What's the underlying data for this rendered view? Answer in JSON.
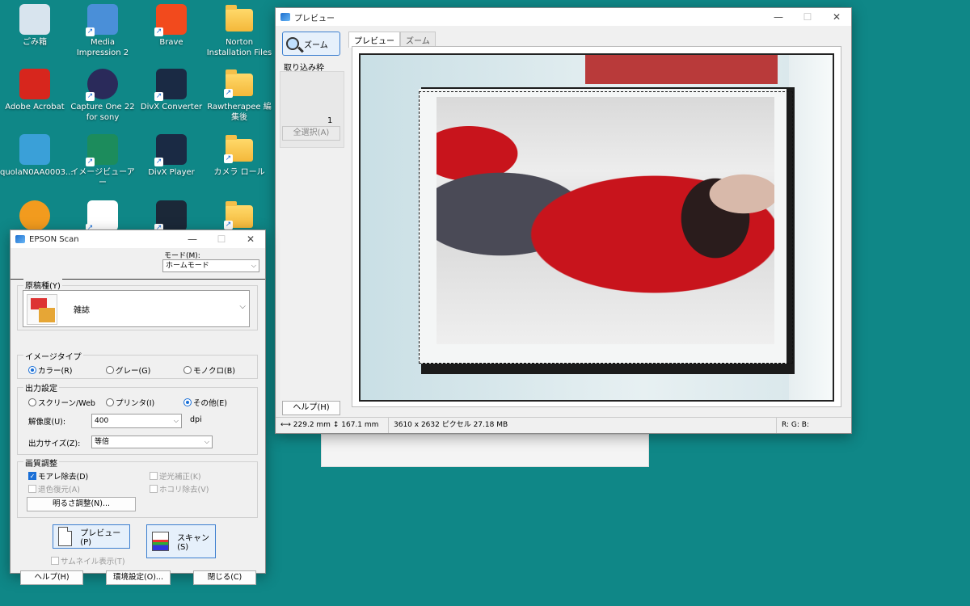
{
  "desktop": {
    "icons": [
      {
        "label": "ごみ箱",
        "icon": "recycle-bin-icon",
        "color": "#d8e4ee"
      },
      {
        "label": "Media Impression 2",
        "icon": "media-impression-icon",
        "color": "#4a8fd8"
      },
      {
        "label": "Brave",
        "icon": "brave-icon",
        "color": "#f24a1d"
      },
      {
        "label": "Norton Installation Files",
        "icon": "folder-icon",
        "color": "#f4c04a"
      },
      {
        "label": "Adobe Acrobat",
        "icon": "adobe-acrobat-icon",
        "color": "#d7261d"
      },
      {
        "label": "Capture One 22 for sony",
        "icon": "capture-one-icon",
        "color": "#2a2a5a"
      },
      {
        "label": "DivX Converter",
        "icon": "divx-converter-icon",
        "color": "#1a2a44"
      },
      {
        "label": "Rawtherapee 編集後",
        "icon": "folder-icon",
        "color": "#f4c04a"
      },
      {
        "label": "quolaN0AA0003...",
        "icon": "laptop-icon",
        "color": "#3aa0d8"
      },
      {
        "label": "イメージビューアー",
        "icon": "fujifilm-icon",
        "color": "#1c8c5c"
      },
      {
        "label": "DivX Player",
        "icon": "divx-player-icon",
        "color": "#1a2a44"
      },
      {
        "label": "カメラ ロール",
        "icon": "folder-icon",
        "color": "#f4c04a"
      },
      {
        "label": "",
        "icon": "color-wheel-icon",
        "color": "#f29b1e"
      },
      {
        "label": "",
        "icon": "cloud-upload-icon",
        "color": "#ffffff"
      },
      {
        "label": "",
        "icon": "steam-icon",
        "color": "#1b2838"
      },
      {
        "label": "",
        "icon": "folder-icon",
        "color": "#f4c04a"
      }
    ]
  },
  "preview_window": {
    "title": "プレビュー",
    "zoom_button": "ズーム",
    "frame_label": "取り込み枠",
    "frame_count": "1",
    "select_all": "全選択(A)",
    "help": "ヘルプ(H)",
    "tabs": [
      {
        "label": "プレビュー",
        "active": true
      },
      {
        "label": "ズーム",
        "active": false
      }
    ],
    "status": {
      "width": "229.2 mm",
      "height": "167.1 mm",
      "pixels": "3610 x 2632 ピクセル 27.18 MB",
      "rgb": "R: G: B:"
    }
  },
  "epson_window": {
    "title": "EPSON Scan",
    "mode_label": "モード(M):",
    "mode_value": "ホームモード",
    "document_type_label": "原稿種(Y)",
    "document_type_value": "雑誌",
    "image_type_label": "イメージタイプ",
    "image_types": [
      {
        "label": "カラー(R)",
        "selected": true
      },
      {
        "label": "グレー(G)",
        "selected": false
      },
      {
        "label": "モノクロ(B)",
        "selected": false
      }
    ],
    "output_label": "出力設定",
    "outputs": [
      {
        "label": "スクリーン/Web",
        "selected": false
      },
      {
        "label": "プリンタ(I)",
        "selected": false
      },
      {
        "label": "その他(E)",
        "selected": true
      }
    ],
    "resolution_label": "解像度(U):",
    "resolution_value": "400",
    "resolution_unit": "dpi",
    "output_size_label": "出力サイズ(Z):",
    "output_size_value": "等倍",
    "quality_label": "画質調整",
    "quality_options": [
      {
        "label": "モアレ除去(D)",
        "checked": true,
        "enabled": true
      },
      {
        "label": "逆光補正(K)",
        "checked": false,
        "enabled": false
      },
      {
        "label": "退色復元(A)",
        "checked": false,
        "enabled": false
      },
      {
        "label": "ホコリ除去(V)",
        "checked": false,
        "enabled": false
      }
    ],
    "brightness_button": "明るさ調整(N)...",
    "preview_button": "プレビュー(P)",
    "scan_button": "スキャン(S)",
    "thumbnail_label": "サムネイル表示(T)",
    "help_button": "ヘルプ(H)",
    "settings_button": "環境設定(O)...",
    "close_button": "閉じる(C)"
  }
}
